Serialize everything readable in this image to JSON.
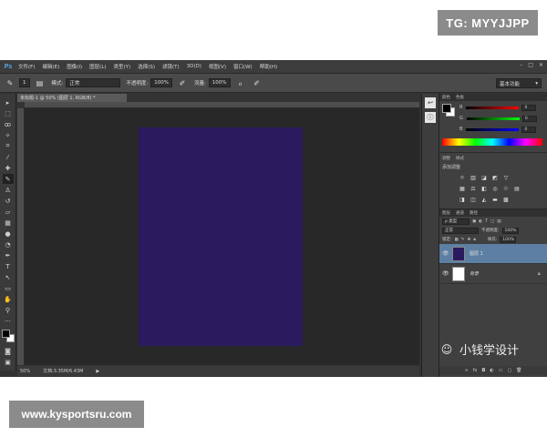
{
  "overlays": {
    "tg_label": "TG: MYYJJPP",
    "site_label": "www.kysportsru.com",
    "wechat_label": "小钱学设计"
  },
  "menubar": {
    "logo": "Ps",
    "items": [
      "文件(F)",
      "编辑(E)",
      "图像(I)",
      "图层(L)",
      "类型(Y)",
      "选择(S)",
      "滤镜(T)",
      "3D(D)",
      "视图(V)",
      "窗口(W)",
      "帮助(H)"
    ]
  },
  "options": {
    "brush_size": "1",
    "mode_label": "模式:",
    "mode_value": "正常",
    "opacity_label": "不透明度:",
    "opacity_value": "100%",
    "flow_label": "流量:",
    "flow_value": "100%",
    "workspace": "基本功能"
  },
  "document": {
    "tab_title": "未标题-1 @ 50% (图层 1, RGB/8) *",
    "canvas_color": "#2a1a5e",
    "zoom": "50%",
    "doc_info": "文档:3.35M/6.43M"
  },
  "color_panel": {
    "tabs": [
      "颜色",
      "色板"
    ],
    "channels": [
      {
        "label": "R",
        "value": "0"
      },
      {
        "label": "G",
        "value": "0"
      },
      {
        "label": "B",
        "value": "0"
      }
    ]
  },
  "adjust_panel": {
    "tabs": [
      "调整",
      "样式"
    ],
    "title": "添加调整"
  },
  "layers_panel": {
    "tabs": [
      "图层",
      "通道",
      "路径"
    ],
    "kind_label": "ρ 类型",
    "blend_mode": "正常",
    "opacity_label": "不透明度:",
    "opacity_value": "100%",
    "lock_label": "锁定:",
    "fill_label": "填充:",
    "fill_value": "100%",
    "layers": [
      {
        "name": "图层 1",
        "thumb_color": "#2a1a5e",
        "selected": true
      },
      {
        "name": "背景",
        "thumb_color": "#ffffff",
        "selected": false
      }
    ]
  }
}
